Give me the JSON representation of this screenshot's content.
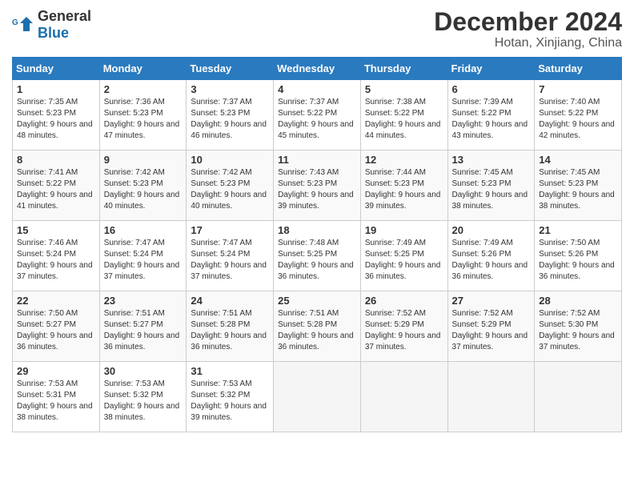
{
  "header": {
    "logo_line1": "General",
    "logo_line2": "Blue",
    "month": "December 2024",
    "location": "Hotan, Xinjiang, China"
  },
  "days_of_week": [
    "Sunday",
    "Monday",
    "Tuesday",
    "Wednesday",
    "Thursday",
    "Friday",
    "Saturday"
  ],
  "weeks": [
    [
      {
        "day": "1",
        "sunrise": "7:35 AM",
        "sunset": "5:23 PM",
        "daylight": "9 hours and 48 minutes."
      },
      {
        "day": "2",
        "sunrise": "7:36 AM",
        "sunset": "5:23 PM",
        "daylight": "9 hours and 47 minutes."
      },
      {
        "day": "3",
        "sunrise": "7:37 AM",
        "sunset": "5:23 PM",
        "daylight": "9 hours and 46 minutes."
      },
      {
        "day": "4",
        "sunrise": "7:37 AM",
        "sunset": "5:22 PM",
        "daylight": "9 hours and 45 minutes."
      },
      {
        "day": "5",
        "sunrise": "7:38 AM",
        "sunset": "5:22 PM",
        "daylight": "9 hours and 44 minutes."
      },
      {
        "day": "6",
        "sunrise": "7:39 AM",
        "sunset": "5:22 PM",
        "daylight": "9 hours and 43 minutes."
      },
      {
        "day": "7",
        "sunrise": "7:40 AM",
        "sunset": "5:22 PM",
        "daylight": "9 hours and 42 minutes."
      }
    ],
    [
      {
        "day": "8",
        "sunrise": "7:41 AM",
        "sunset": "5:22 PM",
        "daylight": "9 hours and 41 minutes."
      },
      {
        "day": "9",
        "sunrise": "7:42 AM",
        "sunset": "5:23 PM",
        "daylight": "9 hours and 40 minutes."
      },
      {
        "day": "10",
        "sunrise": "7:42 AM",
        "sunset": "5:23 PM",
        "daylight": "9 hours and 40 minutes."
      },
      {
        "day": "11",
        "sunrise": "7:43 AM",
        "sunset": "5:23 PM",
        "daylight": "9 hours and 39 minutes."
      },
      {
        "day": "12",
        "sunrise": "7:44 AM",
        "sunset": "5:23 PM",
        "daylight": "9 hours and 39 minutes."
      },
      {
        "day": "13",
        "sunrise": "7:45 AM",
        "sunset": "5:23 PM",
        "daylight": "9 hours and 38 minutes."
      },
      {
        "day": "14",
        "sunrise": "7:45 AM",
        "sunset": "5:23 PM",
        "daylight": "9 hours and 38 minutes."
      }
    ],
    [
      {
        "day": "15",
        "sunrise": "7:46 AM",
        "sunset": "5:24 PM",
        "daylight": "9 hours and 37 minutes."
      },
      {
        "day": "16",
        "sunrise": "7:47 AM",
        "sunset": "5:24 PM",
        "daylight": "9 hours and 37 minutes."
      },
      {
        "day": "17",
        "sunrise": "7:47 AM",
        "sunset": "5:24 PM",
        "daylight": "9 hours and 37 minutes."
      },
      {
        "day": "18",
        "sunrise": "7:48 AM",
        "sunset": "5:25 PM",
        "daylight": "9 hours and 36 minutes."
      },
      {
        "day": "19",
        "sunrise": "7:49 AM",
        "sunset": "5:25 PM",
        "daylight": "9 hours and 36 minutes."
      },
      {
        "day": "20",
        "sunrise": "7:49 AM",
        "sunset": "5:26 PM",
        "daylight": "9 hours and 36 minutes."
      },
      {
        "day": "21",
        "sunrise": "7:50 AM",
        "sunset": "5:26 PM",
        "daylight": "9 hours and 36 minutes."
      }
    ],
    [
      {
        "day": "22",
        "sunrise": "7:50 AM",
        "sunset": "5:27 PM",
        "daylight": "9 hours and 36 minutes."
      },
      {
        "day": "23",
        "sunrise": "7:51 AM",
        "sunset": "5:27 PM",
        "daylight": "9 hours and 36 minutes."
      },
      {
        "day": "24",
        "sunrise": "7:51 AM",
        "sunset": "5:28 PM",
        "daylight": "9 hours and 36 minutes."
      },
      {
        "day": "25",
        "sunrise": "7:51 AM",
        "sunset": "5:28 PM",
        "daylight": "9 hours and 36 minutes."
      },
      {
        "day": "26",
        "sunrise": "7:52 AM",
        "sunset": "5:29 PM",
        "daylight": "9 hours and 37 minutes."
      },
      {
        "day": "27",
        "sunrise": "7:52 AM",
        "sunset": "5:29 PM",
        "daylight": "9 hours and 37 minutes."
      },
      {
        "day": "28",
        "sunrise": "7:52 AM",
        "sunset": "5:30 PM",
        "daylight": "9 hours and 37 minutes."
      }
    ],
    [
      {
        "day": "29",
        "sunrise": "7:53 AM",
        "sunset": "5:31 PM",
        "daylight": "9 hours and 38 minutes."
      },
      {
        "day": "30",
        "sunrise": "7:53 AM",
        "sunset": "5:32 PM",
        "daylight": "9 hours and 38 minutes."
      },
      {
        "day": "31",
        "sunrise": "7:53 AM",
        "sunset": "5:32 PM",
        "daylight": "9 hours and 39 minutes."
      },
      null,
      null,
      null,
      null
    ]
  ],
  "labels": {
    "sunrise": "Sunrise:",
    "sunset": "Sunset:",
    "daylight": "Daylight:"
  }
}
